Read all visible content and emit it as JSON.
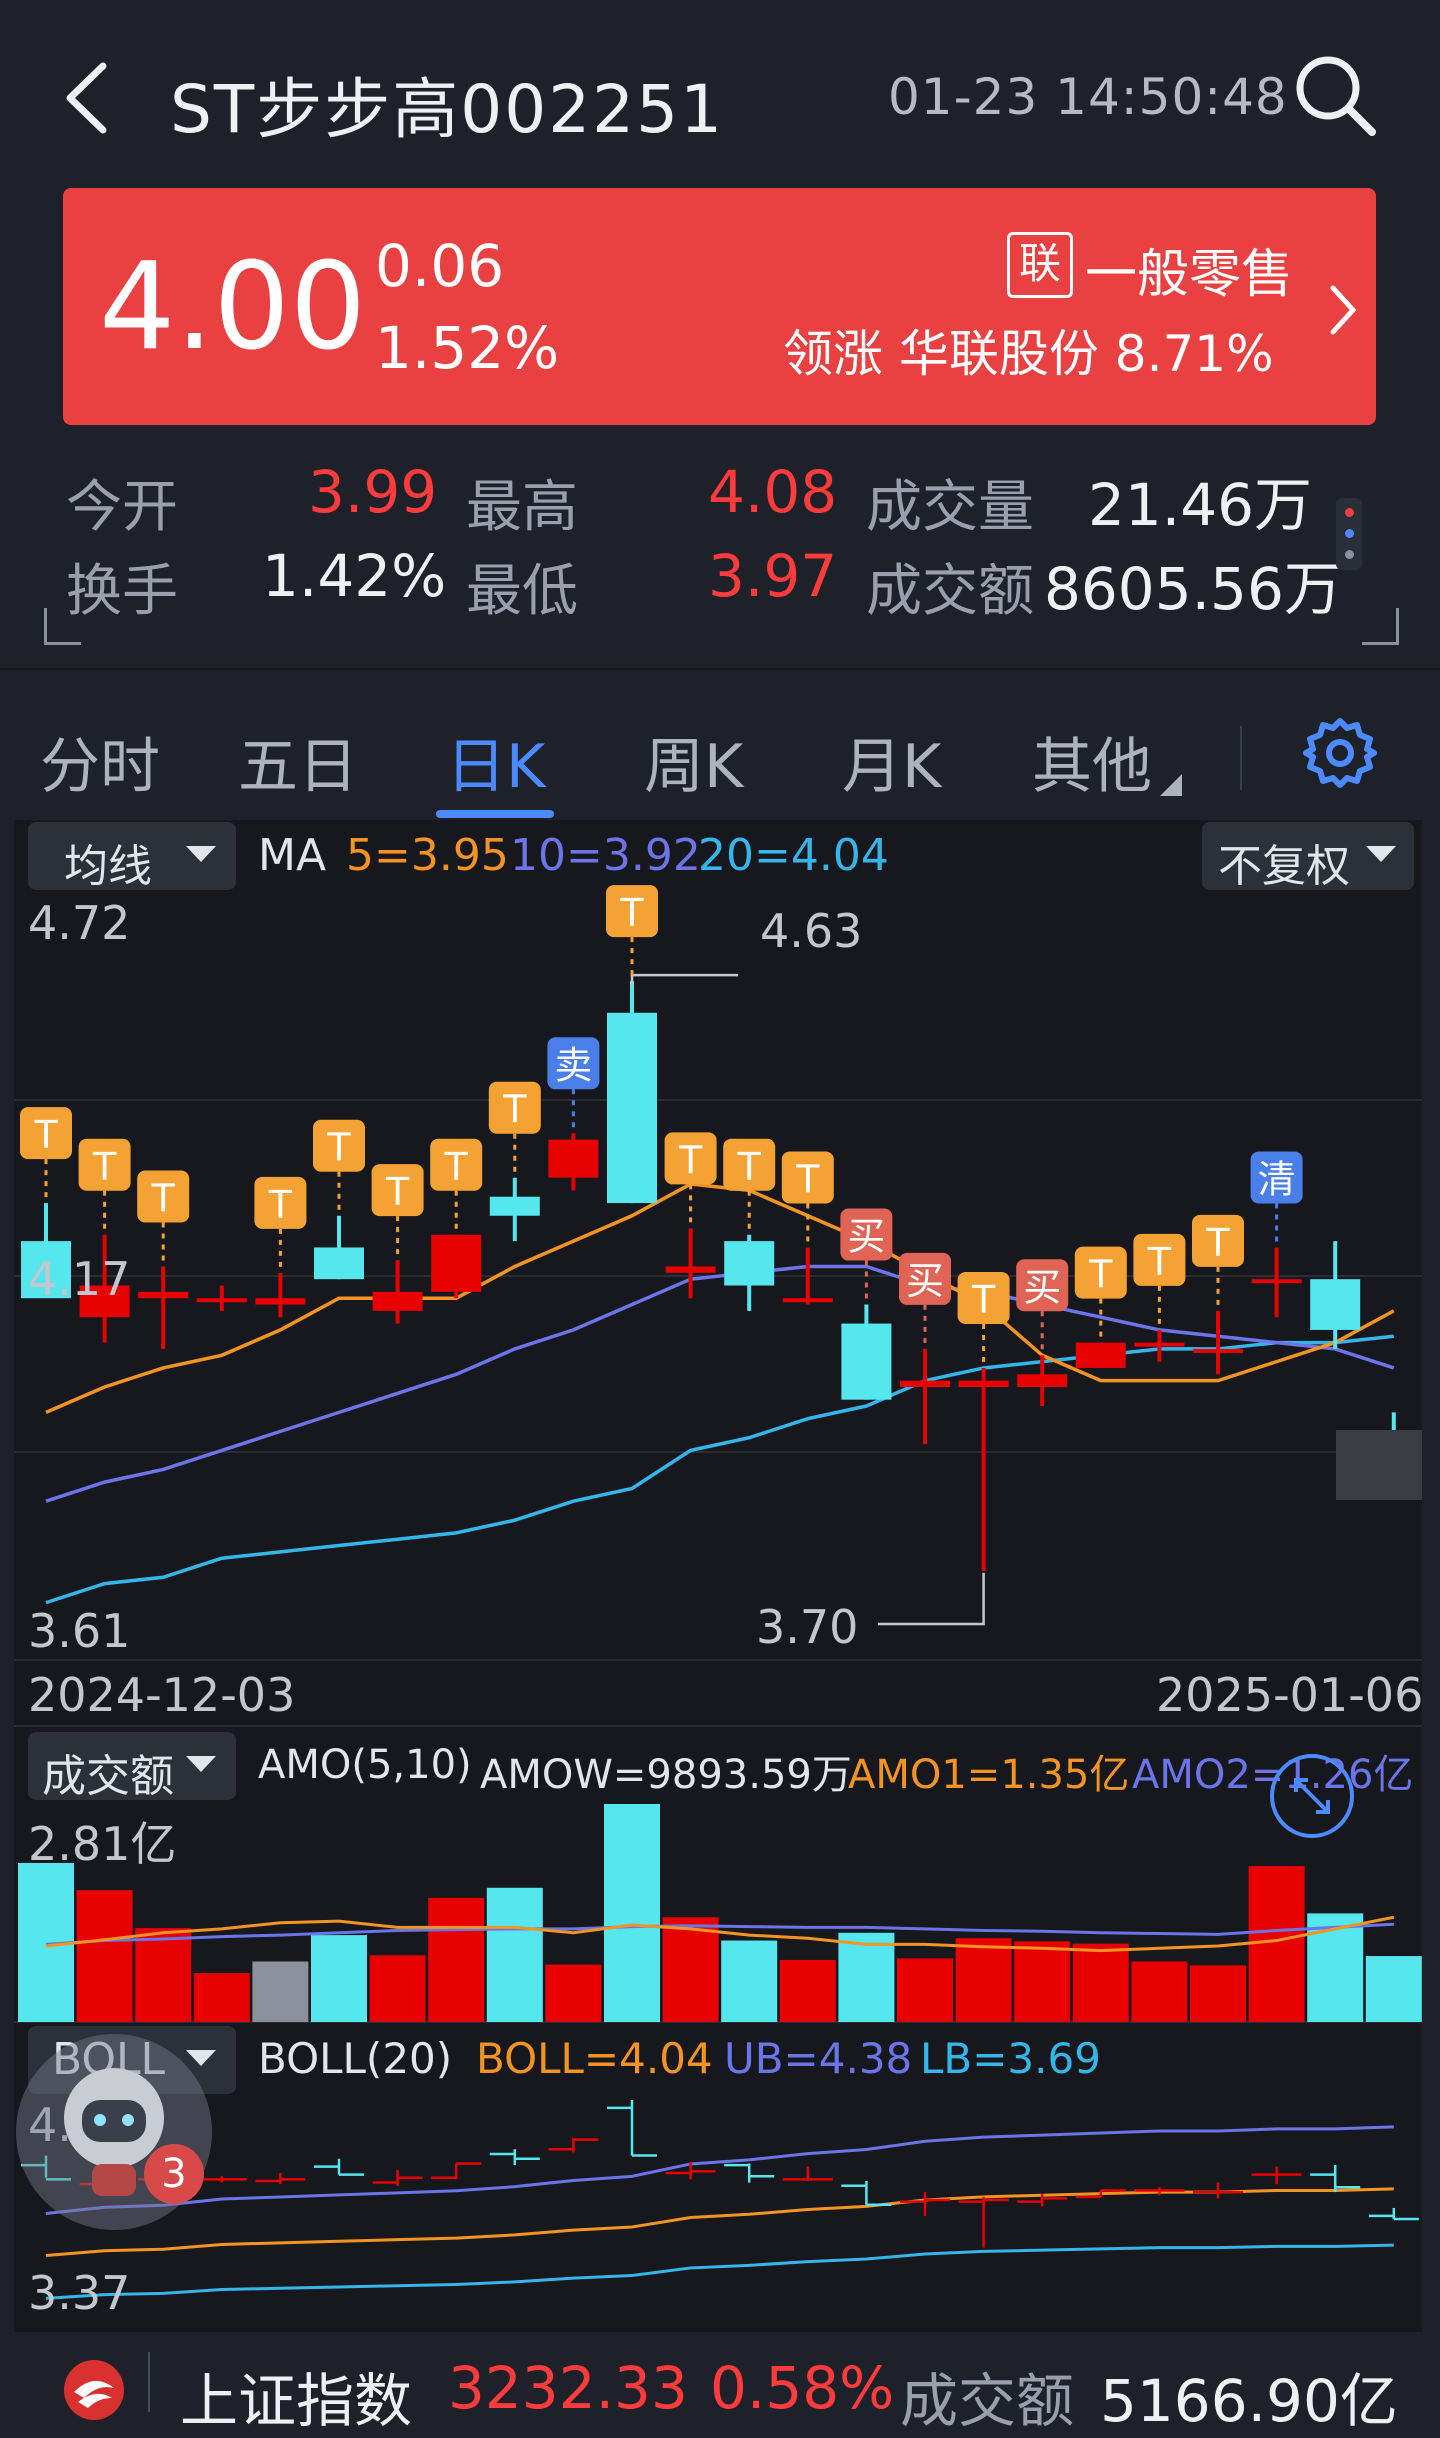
{
  "header": {
    "back_icon": "chevron-left-icon",
    "title": "ST步步高002251",
    "datetime": "01-23 14:50:48",
    "search_icon": "search-icon"
  },
  "quote": {
    "price": "4.00",
    "change": "0.06",
    "change_pct": "1.52%",
    "industry_tag": "联",
    "industry_name": "一般零售",
    "leader_text": "领涨 华联股份 8.71%",
    "card_color": "#e94141"
  },
  "stats": {
    "open_label": "今开",
    "open_value": "3.99",
    "high_label": "最高",
    "high_value": "4.08",
    "volume_label": "成交量",
    "volume_value": "21.46万",
    "turnover_label": "换手",
    "turnover_value": "1.42%",
    "low_label": "最低",
    "low_value": "3.97",
    "amount_label": "成交额",
    "amount_value": "8605.56万"
  },
  "tabs": [
    {
      "label": "分时"
    },
    {
      "label": "五日"
    },
    {
      "label": "日K"
    },
    {
      "label": "周K"
    },
    {
      "label": "月K"
    },
    {
      "label": "其他"
    }
  ],
  "active_tab": "日K",
  "kline": {
    "indicator_select": "均线",
    "ma_label": "MA",
    "ma5": "5=3.95",
    "ma10": "10=3.92",
    "ma20": "20=4.04",
    "adjust_select": "不复权",
    "y_top": "4.72",
    "y_mid": "4.17",
    "y_bottom": "3.61",
    "max_marker": "4.63",
    "min_marker": "3.70",
    "date_start": "2024-12-03",
    "date_end": "2025-01-06",
    "colors": {
      "up": "#e80000",
      "down": "#55e6ee",
      "ma5": "#f39422",
      "ma10": "#6b74e8",
      "ma20": "#35b6ea"
    }
  },
  "chart_data": {
    "type": "candlestick",
    "y_range": [
      3.61,
      4.72
    ],
    "candles": [
      {
        "o": 4.22,
        "h": 4.28,
        "l": 4.14,
        "c": 4.13
      },
      {
        "o": 4.1,
        "h": 4.23,
        "l": 4.06,
        "c": 4.15
      },
      {
        "o": 4.13,
        "h": 4.18,
        "l": 4.05,
        "c": 4.14
      },
      {
        "o": 4.13,
        "h": 4.15,
        "l": 4.11,
        "c": 4.13
      },
      {
        "o": 4.12,
        "h": 4.17,
        "l": 4.1,
        "c": 4.13
      },
      {
        "o": 4.21,
        "h": 4.26,
        "l": 4.16,
        "c": 4.16
      },
      {
        "o": 4.11,
        "h": 4.19,
        "l": 4.09,
        "c": 4.14
      },
      {
        "o": 4.14,
        "h": 4.23,
        "l": 4.13,
        "c": 4.23
      },
      {
        "o": 4.29,
        "h": 4.32,
        "l": 4.22,
        "c": 4.26
      },
      {
        "o": 4.32,
        "h": 4.39,
        "l": 4.3,
        "c": 4.38
      },
      {
        "o": 4.58,
        "h": 4.63,
        "l": 4.28,
        "c": 4.28
      },
      {
        "o": 4.17,
        "h": 4.24,
        "l": 4.13,
        "c": 4.18
      },
      {
        "o": 4.22,
        "h": 4.23,
        "l": 4.11,
        "c": 4.15
      },
      {
        "o": 4.13,
        "h": 4.21,
        "l": 4.12,
        "c": 4.13
      },
      {
        "o": 4.09,
        "h": 4.12,
        "l": 3.97,
        "c": 3.97
      },
      {
        "o": 3.99,
        "h": 4.05,
        "l": 3.9,
        "c": 4.0
      },
      {
        "o": 3.99,
        "h": 4.02,
        "l": 3.7,
        "c": 4.0
      },
      {
        "o": 3.99,
        "h": 4.04,
        "l": 3.96,
        "c": 4.01
      },
      {
        "o": 4.02,
        "h": 4.06,
        "l": 4.02,
        "c": 4.06
      },
      {
        "o": 4.06,
        "h": 4.08,
        "l": 4.03,
        "c": 4.06
      },
      {
        "o": 4.05,
        "h": 4.11,
        "l": 4.01,
        "c": 4.05
      },
      {
        "o": 4.16,
        "h": 4.21,
        "l": 4.1,
        "c": 4.16
      },
      {
        "o": 4.16,
        "h": 4.22,
        "l": 4.05,
        "c": 4.08
      },
      {
        "o": 3.9,
        "h": 3.95,
        "l": 3.88,
        "c": 3.88
      }
    ],
    "ma5": [
      3.95,
      3.99,
      4.02,
      4.04,
      4.08,
      4.13,
      4.13,
      4.13,
      4.18,
      4.22,
      4.26,
      4.31,
      4.3,
      4.26,
      4.22,
      4.17,
      4.12,
      4.04,
      4.0,
      4.0,
      4.0,
      4.03,
      4.06,
      4.11
    ],
    "ma10": [
      3.81,
      3.84,
      3.86,
      3.89,
      3.92,
      3.95,
      3.98,
      4.01,
      4.05,
      4.08,
      4.12,
      4.16,
      4.17,
      4.18,
      4.18,
      4.15,
      4.14,
      4.12,
      4.1,
      4.08,
      4.07,
      4.06,
      4.05,
      4.02
    ],
    "ma20": [
      3.65,
      3.68,
      3.69,
      3.72,
      3.73,
      3.74,
      3.75,
      3.76,
      3.78,
      3.81,
      3.83,
      3.89,
      3.91,
      3.94,
      3.96,
      4.0,
      4.02,
      4.03,
      4.04,
      4.05,
      4.05,
      4.06,
      4.06,
      4.07
    ],
    "signals": [
      {
        "i": 0,
        "text": "T"
      },
      {
        "i": 1,
        "text": "T"
      },
      {
        "i": 2,
        "text": "T"
      },
      {
        "i": 4,
        "text": "T"
      },
      {
        "i": 5,
        "text": "T"
      },
      {
        "i": 6,
        "text": "T"
      },
      {
        "i": 7,
        "text": "T"
      },
      {
        "i": 8,
        "text": "T"
      },
      {
        "i": 9,
        "text": "卖"
      },
      {
        "i": 10,
        "text": "T"
      },
      {
        "i": 11,
        "text": "T"
      },
      {
        "i": 12,
        "text": "T"
      },
      {
        "i": 13,
        "text": "T"
      },
      {
        "i": 14,
        "text": "买"
      },
      {
        "i": 15,
        "text": "买"
      },
      {
        "i": 16,
        "text": "T"
      },
      {
        "i": 17,
        "text": "买"
      },
      {
        "i": 18,
        "text": "T"
      },
      {
        "i": 19,
        "text": "T"
      },
      {
        "i": 20,
        "text": "T"
      },
      {
        "i": 21,
        "text": "清"
      }
    ],
    "volume": {
      "amo_values": [
        2.05,
        1.7,
        1.21,
        0.63,
        0.78,
        1.12,
        0.86,
        1.6,
        1.73,
        0.74,
        2.81,
        1.35,
        1.05,
        0.8,
        1.15,
        0.82,
        1.08,
        1.04,
        1.01,
        0.78,
        0.73,
        2.01,
        1.4,
        0.85
      ],
      "amo1": [
        0.98,
        1.06,
        1.15,
        1.2,
        1.28,
        1.3,
        1.22,
        1.22,
        1.22,
        1.15,
        1.25,
        1.2,
        1.12,
        1.08,
        1.0,
        1.0,
        0.97,
        0.95,
        0.92,
        0.95,
        0.98,
        1.05,
        1.2,
        1.35
      ],
      "amo2": [
        1.0,
        1.05,
        1.07,
        1.1,
        1.12,
        1.15,
        1.18,
        1.19,
        1.2,
        1.2,
        1.23,
        1.24,
        1.23,
        1.22,
        1.22,
        1.2,
        1.18,
        1.17,
        1.15,
        1.14,
        1.13,
        1.18,
        1.22,
        1.26
      ],
      "ylim": [
        0,
        2.81
      ]
    }
  },
  "amo": {
    "select": "成交额",
    "params": "AMO(5,10)",
    "amow": "AMOW=9893.59万",
    "amo1": "AMO1=1.35亿",
    "amo2": "AMO2=1.26亿",
    "y_top": "2.81亿"
  },
  "boll": {
    "select": "BOLL",
    "params": "BOLL(20)",
    "boll": "BOLL=4.04",
    "ub": "UB=4.38",
    "lb": "LB=3.69",
    "y_top": "4.63",
    "y_bottom": "3.37",
    "badge": "3"
  },
  "ticker": {
    "name": "上证指数",
    "value": "3232.33",
    "pct": "0.58%",
    "amount_label": "成交额",
    "amount_value": "5166.90亿"
  }
}
